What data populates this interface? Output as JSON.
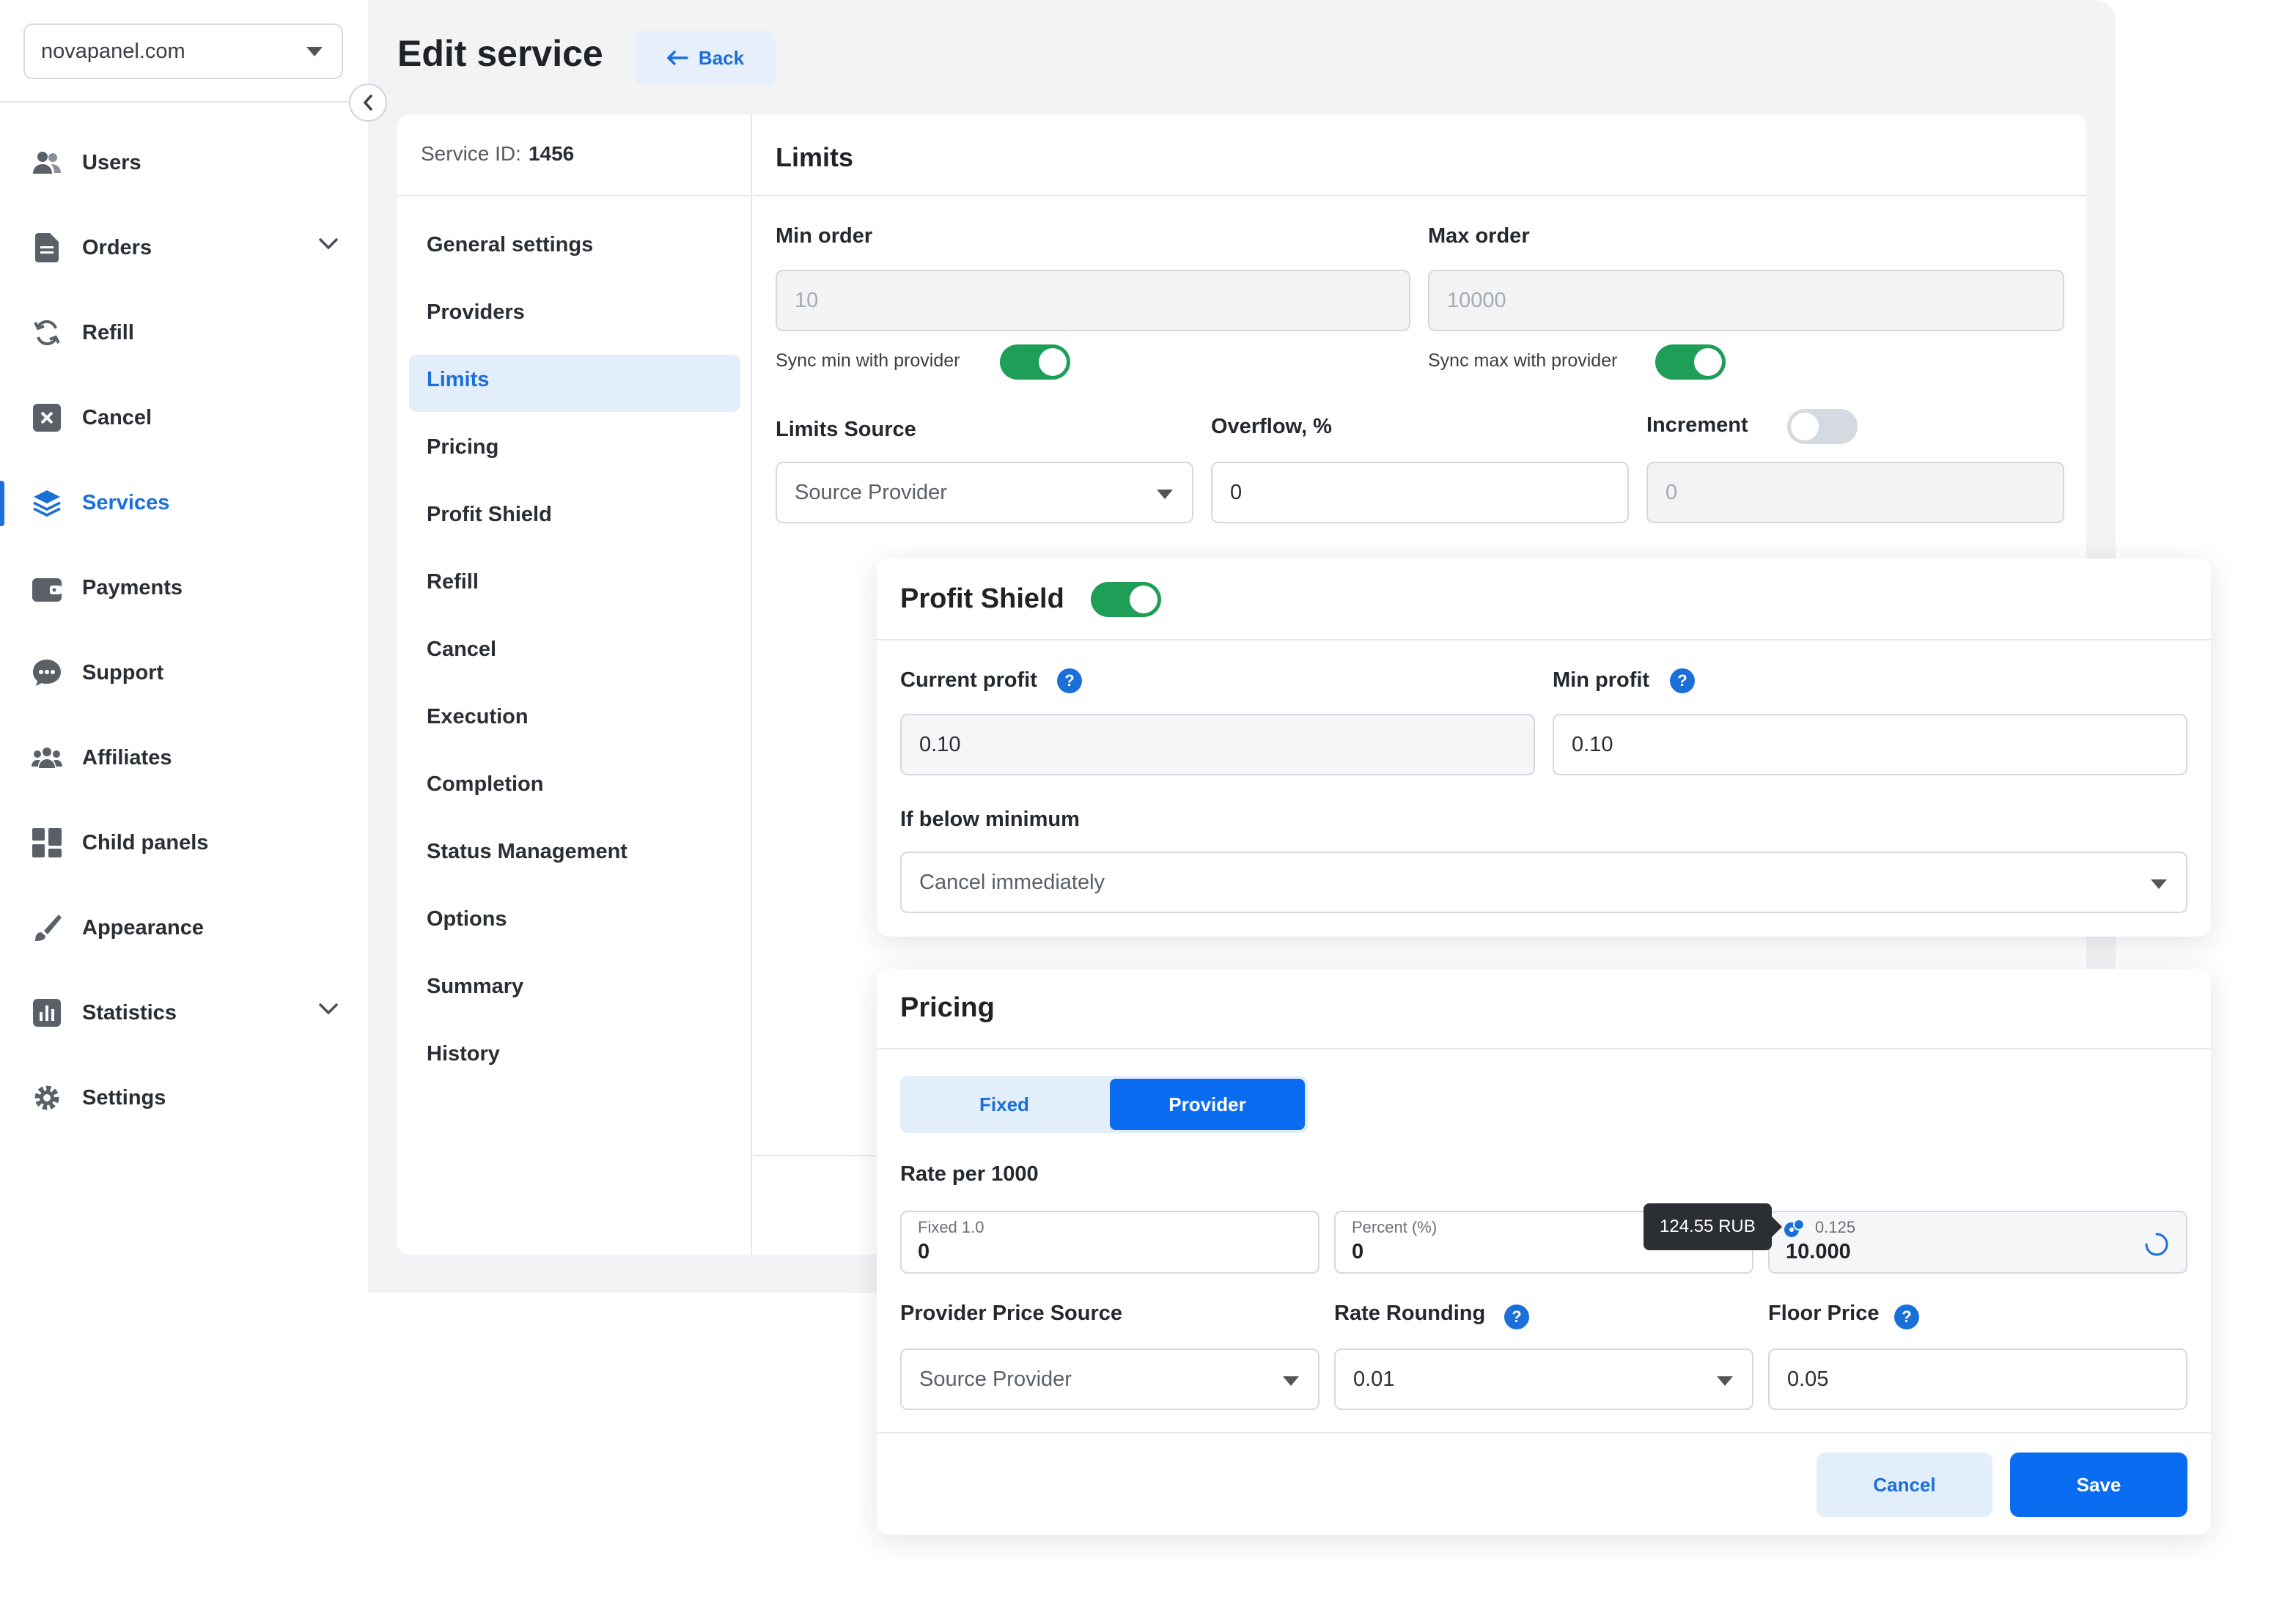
{
  "sidebar": {
    "domain": "novapanel.com",
    "items": [
      {
        "label": "Users",
        "icon": "users-icon"
      },
      {
        "label": "Orders",
        "icon": "document-icon"
      },
      {
        "label": "Refill",
        "icon": "refresh-icon"
      },
      {
        "label": "Cancel",
        "icon": "cancel-icon"
      },
      {
        "label": "Services",
        "icon": "layers-icon",
        "active": true
      },
      {
        "label": "Payments",
        "icon": "wallet-icon"
      },
      {
        "label": "Support",
        "icon": "chat-icon"
      },
      {
        "label": "Affiliates",
        "icon": "group-icon"
      },
      {
        "label": "Child panels",
        "icon": "grid-icon"
      },
      {
        "label": "Appearance",
        "icon": "brush-icon"
      },
      {
        "label": "Statistics",
        "icon": "chart-icon"
      },
      {
        "label": "Settings",
        "icon": "gear-icon"
      }
    ]
  },
  "header": {
    "title": "Edit service",
    "back_label": "Back"
  },
  "service": {
    "id_label": "Service ID:",
    "id_value": "1456",
    "nav": [
      "General settings",
      "Providers",
      "Limits",
      "Pricing",
      "Profit Shield",
      "Refill",
      "Cancel",
      "Execution",
      "Completion",
      "Status Management",
      "Options",
      "Summary",
      "History"
    ],
    "active_nav": "Limits"
  },
  "limits": {
    "title": "Limits",
    "min_order_label": "Min order",
    "min_order_value": "10",
    "max_order_label": "Max order",
    "max_order_value": "10000",
    "sync_min_label": "Sync min with provider",
    "sync_max_label": "Sync max with provider",
    "source_label": "Limits Source",
    "source_value": "Source Provider",
    "overflow_label": "Overflow, %",
    "overflow_value": "0",
    "increment_label": "Increment",
    "increment_value": "0"
  },
  "profit_shield": {
    "title": "Profit Shield",
    "current_profit_label": "Current profit",
    "current_profit_value": "0.10",
    "min_profit_label": "Min profit",
    "min_profit_value": "0.10",
    "below_min_label": "If below minimum",
    "below_min_value": "Cancel immediately"
  },
  "pricing": {
    "title": "Pricing",
    "mode_fixed": "Fixed",
    "mode_provider": "Provider",
    "rate_label": "Rate per 1000",
    "fixed_caption": "Fixed 1.0",
    "fixed_value": "0",
    "percent_caption": "Percent (%)",
    "percent_value": "0",
    "tooltip": "124.55 RUB",
    "provider_caption": "0.125",
    "provider_value": "10.000",
    "price_source_label": "Provider Price Source",
    "price_source_value": "Source Provider",
    "rounding_label": "Rate Rounding",
    "rounding_value": "0.01",
    "floor_label": "Floor Price",
    "floor_value": "0.05",
    "cancel_label": "Cancel",
    "save_label": "Save"
  },
  "colors": {
    "accent": "#0a6cf0",
    "toggle_on": "#1e9e57"
  }
}
